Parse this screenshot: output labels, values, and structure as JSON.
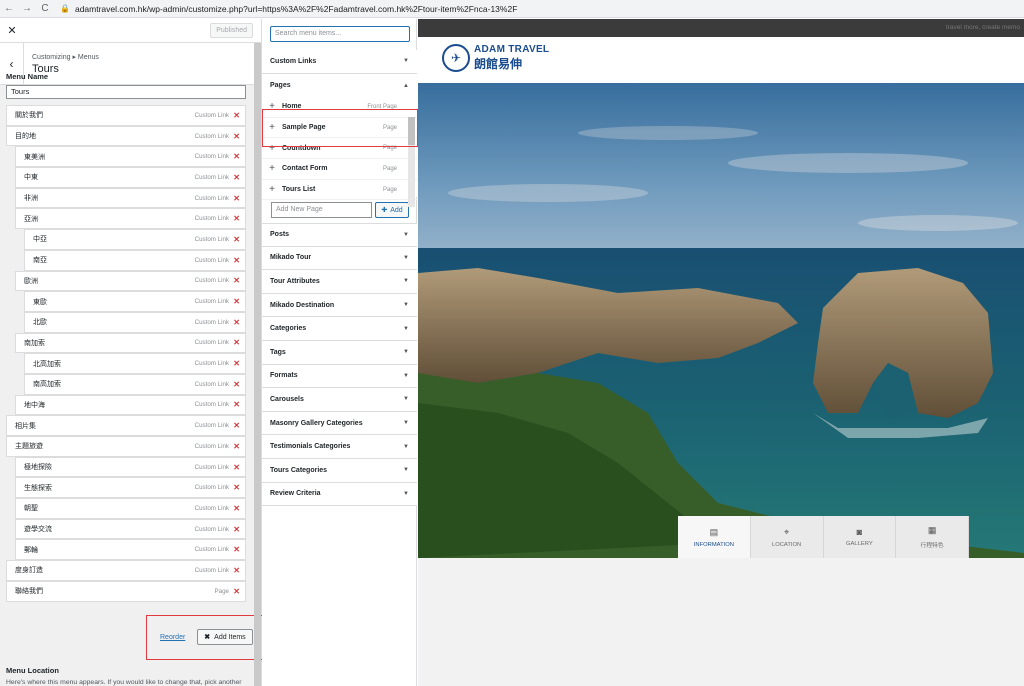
{
  "browser": {
    "back": "←",
    "forward": "→",
    "reload": "C",
    "url": "adamtravel.com.hk/wp-admin/customize.php?url=https%3A%2F%2Fadamtravel.com.hk%2Ftour-item%2Fnca-13%2F"
  },
  "customizer": {
    "published_label": "Published",
    "breadcrumb": "Customizing ▸ Menus",
    "title": "Tours",
    "menu_name_label": "Menu Name",
    "menu_name_value": "Tours",
    "items": [
      {
        "title": "關於我們",
        "type": "Custom Link",
        "indent": 0
      },
      {
        "title": "目的地",
        "type": "Custom Link",
        "indent": 0
      },
      {
        "title": "東美洲",
        "type": "Custom Link",
        "indent": 1
      },
      {
        "title": "中東",
        "type": "Custom Link",
        "indent": 1
      },
      {
        "title": "非洲",
        "type": "Custom Link",
        "indent": 1
      },
      {
        "title": "亞洲",
        "type": "Custom Link",
        "indent": 1
      },
      {
        "title": "中亞",
        "type": "Custom Link",
        "indent": 2
      },
      {
        "title": "南亞",
        "type": "Custom Link",
        "indent": 2
      },
      {
        "title": "歐洲",
        "type": "Custom Link",
        "indent": 1
      },
      {
        "title": "東歐",
        "type": "Custom Link",
        "indent": 2
      },
      {
        "title": "北歐",
        "type": "Custom Link",
        "indent": 2
      },
      {
        "title": "南加索",
        "type": "Custom Link",
        "indent": 1
      },
      {
        "title": "北高加索",
        "type": "Custom Link",
        "indent": 2
      },
      {
        "title": "南高加索",
        "type": "Custom Link",
        "indent": 2
      },
      {
        "title": "地中海",
        "type": "Custom Link",
        "indent": 1
      },
      {
        "title": "相片集",
        "type": "Custom Link",
        "indent": 0
      },
      {
        "title": "主題旅遊",
        "type": "Custom Link",
        "indent": 0
      },
      {
        "title": "極地探險",
        "type": "Custom Link",
        "indent": 1
      },
      {
        "title": "生態探索",
        "type": "Custom Link",
        "indent": 1
      },
      {
        "title": "朝聖",
        "type": "Custom Link",
        "indent": 1
      },
      {
        "title": "遊學交流",
        "type": "Custom Link",
        "indent": 1
      },
      {
        "title": "郵輪",
        "type": "Custom Link",
        "indent": 1
      },
      {
        "title": "度身訂造",
        "type": "Custom Link",
        "indent": 0
      },
      {
        "title": "聯絡我們",
        "type": "Page",
        "indent": 0
      }
    ],
    "reorder_label": "Reorder",
    "add_items_label": "Add Items",
    "menu_location_label": "Menu Location",
    "menu_location_desc": "Here's where this menu appears. If you would like to change that, pick another"
  },
  "available": {
    "search_placeholder": "Search menu items...",
    "custom_links": "Custom Links",
    "pages": "Pages",
    "page_items": [
      {
        "title": "Home",
        "type": "Front Page"
      },
      {
        "title": "Sample Page",
        "type": "Page"
      },
      {
        "title": "Countdown",
        "type": "Page"
      },
      {
        "title": "Contact Form",
        "type": "Page"
      },
      {
        "title": "Tours List",
        "type": "Page"
      }
    ],
    "add_new_page_placeholder": "Add New Page",
    "add_label": "Add",
    "sections": [
      "Posts",
      "Mikado Tour",
      "Tour Attributes",
      "Mikado Destination",
      "Categories",
      "Tags",
      "Formats",
      "Carousels",
      "Masonry Gallery Categories",
      "Testimonials Categories",
      "Tours Categories",
      "Review Criteria"
    ]
  },
  "preview": {
    "tagline": "travel more, create memo",
    "logo_en": "ADAM TRAVEL",
    "logo_zh": "朗館易伸",
    "tabs": [
      {
        "label": "INFORMATION",
        "icon": "document-icon"
      },
      {
        "label": "LOCATION",
        "icon": "pin-icon"
      },
      {
        "label": "GALLERY",
        "icon": "camera-icon"
      },
      {
        "label": "行程特色",
        "icon": "clipboard-icon"
      }
    ]
  },
  "colors": {
    "accent": "#2271b1",
    "delete": "#d63638",
    "brand": "#1a4c8f",
    "highlight": "#e0393e"
  }
}
